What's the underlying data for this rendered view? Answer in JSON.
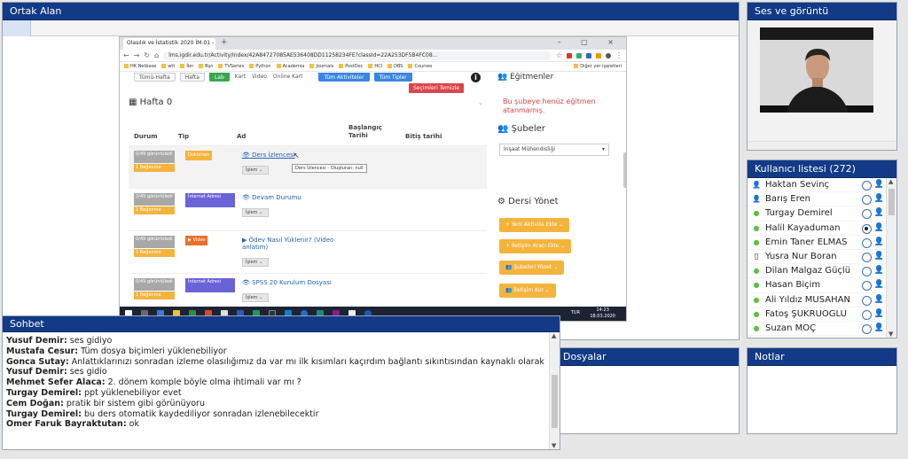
{
  "ortak": {
    "title": "Ortak Alan",
    "browser": {
      "tab_title": "Olasılık ve İstatistik 2020 İM-01 -",
      "tab_close": "×",
      "new_tab": "+",
      "window_controls": "– ▢ ×",
      "url": "lms.igdir.edu.tr/Activity/Index/42A84727085AE536408DD11258234FE?classId=22A253DF5B4FC08...",
      "bookmarks": [
        "HK Netbase",
        "wtt",
        "İbn",
        "Bşn",
        "TVSeries",
        "Python",
        "Academia",
        "Journals",
        "PostDoc",
        "HCI",
        "DBS",
        "Courses",
        "Diğer yer işaretleri"
      ],
      "status_url": "https://lms.igdir.edu.tr/Activity/Launch?id=4E5A6A2A0A0C637288D5C7D2...",
      "clock_time": "14:23",
      "clock_date": "18.03.2020",
      "lang": "TUR"
    },
    "lms": {
      "filters": [
        "Tümü-Hafta",
        "Hafta",
        "Lab",
        "Kart",
        "Video",
        "Online Kart",
        "Tüm Aktiviteler",
        "Tüm Tipler"
      ],
      "clear_button": "Seçimleri Temizle",
      "week_title": "Hafta 0",
      "columns": {
        "durum": "Durum",
        "tip": "Tip",
        "ad": "Ad",
        "baslangic": "Başlangıç Tarihi",
        "bitis": "Bitiş tarihi"
      },
      "rows": [
        {
          "status": "0/49 görüntüledi",
          "grade": "1 Beğenme",
          "type": "Doküman",
          "name": "Ders İzlencesi",
          "action": "İşlem ⌄",
          "tooltip": "Ders İzlencesi - Oluşturan: null"
        },
        {
          "status": "2/49 görüntüledi",
          "grade": "1 Beğenme",
          "type": "İnternet Adresi",
          "name": "Devam Durumu",
          "action": "İşlem ⌄"
        },
        {
          "status": "0/49 görüntüledi",
          "grade": "1 Beğenme",
          "type": "Video",
          "name": "Ödev Nasıl Yüklenir? (Video anlatım)",
          "action": "İşlem ⌄"
        },
        {
          "status": "0/49 görüntüledi",
          "grade": "1 Beğenme",
          "type": "İnternet Adresi",
          "name": "SPSS 20 Kurulum Dosyası",
          "action": "İşlem ⌄"
        }
      ],
      "egitmenler_title": "Eğitmenler",
      "no_instructor": "Bu şubeye henüz eğitmen atanmamış.",
      "subeler_title": "Şubeler",
      "sube_select": "İnşaat Mühendisliği",
      "dersi_yonet_title": "Dersi Yönet",
      "manage_buttons": [
        "Yeni Aktivite Ekle",
        "İletişim Aracı Ekle",
        "Şubeleri Yönet",
        "İletişim Kur"
      ]
    }
  },
  "ses": {
    "title": "Ses ve görüntü"
  },
  "kullanici": {
    "title": "Kullanıcı listesi (272)",
    "users": [
      {
        "name": "Haktan Sevinç",
        "role": "moderator",
        "selected": false
      },
      {
        "name": "Barış Eren",
        "role": "moderator",
        "selected": false
      },
      {
        "name": "Turgay Demirel",
        "role": "online",
        "selected": false
      },
      {
        "name": "Halil Kayaduman",
        "role": "online",
        "selected": true
      },
      {
        "name": "Emin Taner ELMAS",
        "role": "online",
        "selected": false
      },
      {
        "name": "Yusra Nur Boran",
        "role": "mobile",
        "selected": false
      },
      {
        "name": "Dilan Malgaz Güçlü",
        "role": "online",
        "selected": false
      },
      {
        "name": "Hasan Biçim",
        "role": "online",
        "selected": false
      },
      {
        "name": "Ali Yıldız MUSAHAN",
        "role": "online",
        "selected": false
      },
      {
        "name": "Fatoş ŞÜKRÜOĞLU",
        "role": "online",
        "selected": false
      },
      {
        "name": "Suzan MOÇ",
        "role": "online",
        "selected": false
      }
    ]
  },
  "dosyalar": {
    "title": "Dosyalar"
  },
  "notlar": {
    "title": "Notlar"
  },
  "sohbet": {
    "title": "Sohbet",
    "messages": [
      {
        "author": "Yusuf Demir:",
        "text": " ses gidiyo"
      },
      {
        "author": "Mustafa Cesur:",
        "text": " Tüm dosya biçimleri yüklenebiliyor"
      },
      {
        "author": "Gonca Sutay:",
        "text": " Anlattıklarınızı sonradan izleme olasılığımız da var mı ilk kısımları kaçırdım bağlantı sıkıntısından kaynaklı olarak"
      },
      {
        "author": "Yusuf Demir:",
        "text": " ses gidio"
      },
      {
        "author": "Mehmet Sefer Alaca:",
        "text": " 2. dönem komple böyle olma ihtimali var mı ?"
      },
      {
        "author": "Turgay Demirel:",
        "text": " ppt yüklenebiliyor evet"
      },
      {
        "author": "Cem Doğan:",
        "text": " pratik bir sistem gibi görünüyoru"
      },
      {
        "author": "Turgay Demirel:",
        "text": " bu ders otomatik kaydediliyor sonradan izlenebilecektir"
      },
      {
        "author": "Ömer Faruk Bayraktutan:",
        "text": " ok"
      }
    ]
  },
  "colors": {
    "header_blue": "#123a86",
    "accent_orange": "#f4b43c",
    "danger_red": "#d9464b",
    "link_blue": "#1f62b4",
    "presence_green": "#5fbf47"
  }
}
